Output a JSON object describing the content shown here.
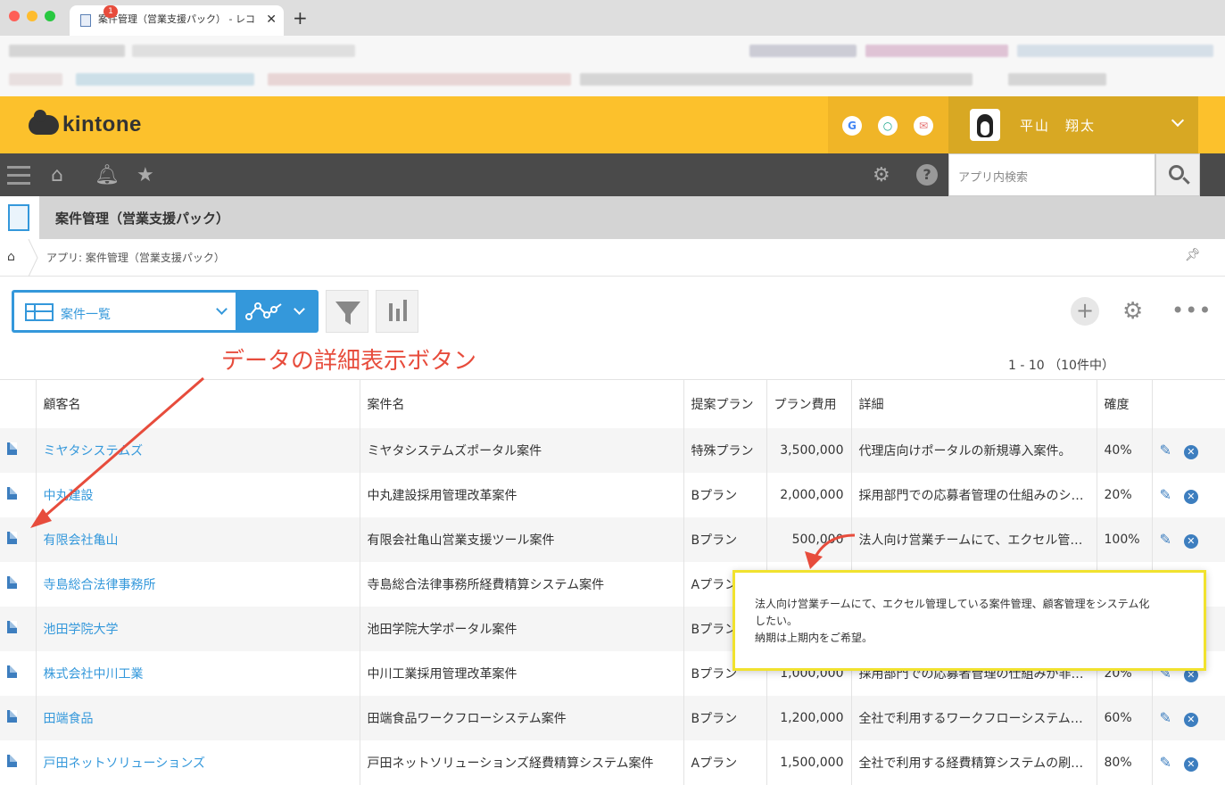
{
  "browser": {
    "tab_title": "案件管理（営業支援パック） - レコ",
    "tab_close": "✕",
    "new_tab": "+"
  },
  "header": {
    "logo_text": "kintone",
    "icons": [
      "G",
      "○",
      "✉"
    ],
    "user_name": "平山　翔太"
  },
  "navbar": {
    "notification_count": "1",
    "search_placeholder": "アプリ内検索"
  },
  "app": {
    "title": "案件管理（営業支援パック）",
    "breadcrumb": "アプリ: 案件管理（営業支援パック）"
  },
  "toolbar": {
    "view_name": "案件一覧",
    "add_label": "+",
    "more_label": "•••"
  },
  "annotation": "データの詳細表示ボタン",
  "pagination": "1 - 10 （10件中）",
  "table": {
    "headers": [
      "顧客名",
      "案件名",
      "提案プラン",
      "プラン費用",
      "詳細",
      "確度"
    ],
    "rows": [
      {
        "customer": "ミヤタシステムズ",
        "project": "ミヤタシステムズポータル案件",
        "plan": "特殊プラン",
        "cost": "3,500,000",
        "detail": "代理店向けポータルの新規導入案件。",
        "prob": "40%"
      },
      {
        "customer": "中丸建設",
        "project": "中丸建設採用管理改革案件",
        "plan": "Bプラン",
        "cost": "2,000,000",
        "detail": "採用部門での応募者管理の仕組みのシ…",
        "prob": "20%"
      },
      {
        "customer": "有限会社亀山",
        "project": "有限会社亀山営業支援ツール案件",
        "plan": "Bプラン",
        "cost": "500,000",
        "detail": "法人向け営業チームにて、エクセル管…",
        "prob": "100%"
      },
      {
        "customer": "寺島総合法律事務所",
        "project": "寺島総合法律事務所経費精算システム案件",
        "plan": "Aプラン",
        "cost": "",
        "detail": "",
        "prob": ""
      },
      {
        "customer": "池田学院大学",
        "project": "池田学院大学ポータル案件",
        "plan": "Bプラン",
        "cost": "",
        "detail": "",
        "prob": ""
      },
      {
        "customer": "株式会社中川工業",
        "project": "中川工業採用管理改革案件",
        "plan": "Bプラン",
        "cost": "1,000,000",
        "detail": "採用部門での応募者管理の仕組みが非…",
        "prob": "20%"
      },
      {
        "customer": "田端食品",
        "project": "田端食品ワークフローシステム案件",
        "plan": "Bプラン",
        "cost": "1,200,000",
        "detail": "全社で利用するワークフローシステム…",
        "prob": "60%"
      },
      {
        "customer": "戸田ネットソリューションズ",
        "project": "戸田ネットソリューションズ経費精算システム案件",
        "plan": "Aプラン",
        "cost": "1,500,000",
        "detail": "全社で利用する経費精算システムの刷…",
        "prob": "80%"
      }
    ]
  },
  "tooltip": {
    "line1": "法人向け営業チームにて、エクセル管理している案件管理、顧客管理をシステム化",
    "line2": "したい。",
    "line3": "納期は上期内をご希望。"
  },
  "colors": {
    "brand_yellow": "#fcc12c",
    "accent_blue": "#3498db",
    "annotation_red": "#e74c3c",
    "highlight_yellow": "#f1e22e"
  }
}
